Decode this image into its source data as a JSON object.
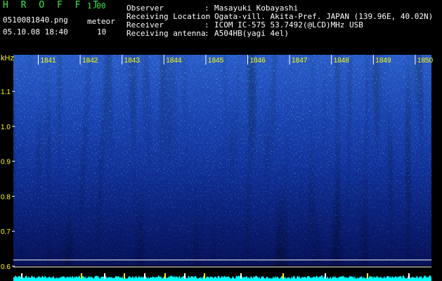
{
  "app": {
    "name": "H R O F F T",
    "version": "1.00"
  },
  "file": {
    "name": "0510081840.png",
    "datetime": "05.10.08 18:40"
  },
  "meteor": {
    "label": "meteor",
    "count": "10"
  },
  "station": [
    {
      "key": "Observer",
      "sep": ":",
      "value": "Masayuki Kobayashi"
    },
    {
      "key": "Receiving Location",
      "sep": ":",
      "value": "Ogata-vill. Akita-Pref. JAPAN (139.96E, 40.02N)"
    },
    {
      "key": "Receiver",
      "sep": ":",
      "value": "ICOM IC-575 53.7492(@LCD)MHz USB"
    },
    {
      "key": "Receiving antenna",
      "sep": ":",
      "value": "A504HB(yagi 4el)"
    }
  ],
  "spectrogram": {
    "y_unit": "kHz",
    "y_ticks": [
      "1.1",
      "1.0",
      "0.9",
      "0.8",
      "0.7",
      "0.6"
    ],
    "time_labels": [
      "1841",
      "1842",
      "1843",
      "1844",
      "1845",
      "1846",
      "1847",
      "1848",
      "1849",
      "1850"
    ],
    "colors": {
      "background": "#000000",
      "label": "#ffff00",
      "tick": "#ffffff",
      "signal": "#00ffff"
    }
  }
}
